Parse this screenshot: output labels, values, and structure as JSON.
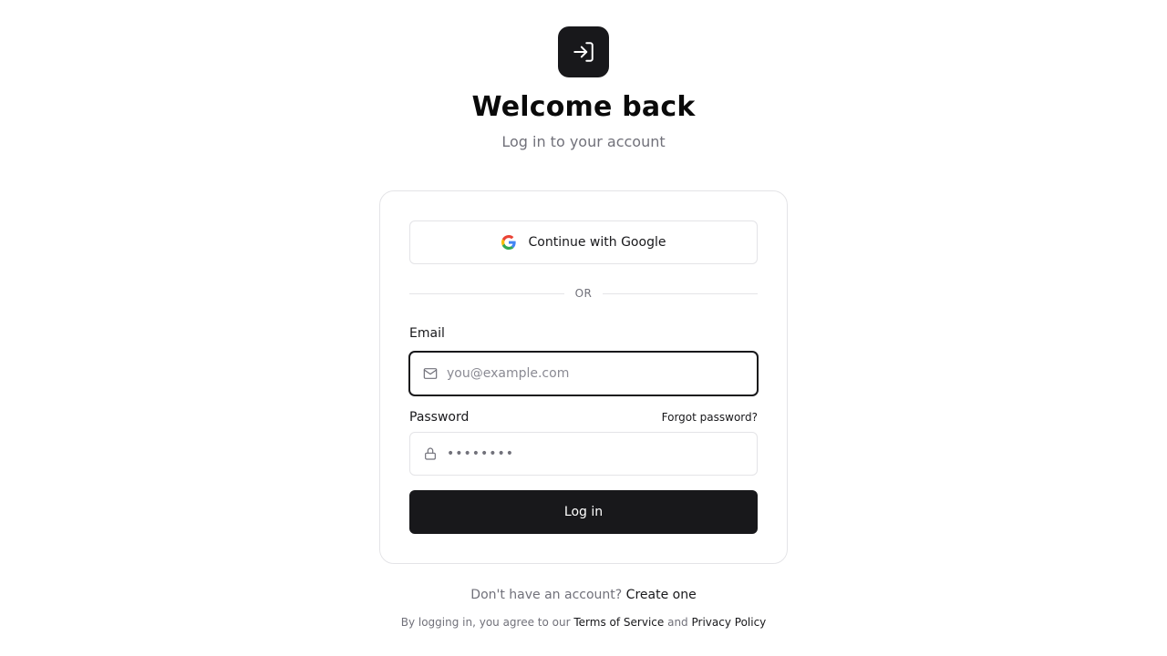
{
  "header": {
    "icon": "log-in-icon",
    "title": "Welcome back",
    "subtitle": "Log in to your account"
  },
  "card": {
    "google_button_label": "Continue with Google",
    "google_icon": "google-icon",
    "divider_text": "OR",
    "email": {
      "label": "Email",
      "icon": "mail-icon",
      "placeholder": "you@example.com",
      "value": ""
    },
    "password": {
      "label": "Password",
      "icon": "lock-icon",
      "placeholder": "••••••••",
      "value": "",
      "forgot_label": "Forgot password?"
    },
    "submit_label": "Log in"
  },
  "footer": {
    "signup_prompt": "Don't have an account?",
    "signup_link": "Create one",
    "legal_prefix": "By logging in, you agree to our",
    "terms_link": "Terms of Service",
    "legal_and": "and",
    "privacy_link": "Privacy Policy"
  },
  "colors": {
    "primary": "#18181b",
    "muted_text": "#71717a",
    "border": "#e4e4e7",
    "background": "#ffffff"
  }
}
